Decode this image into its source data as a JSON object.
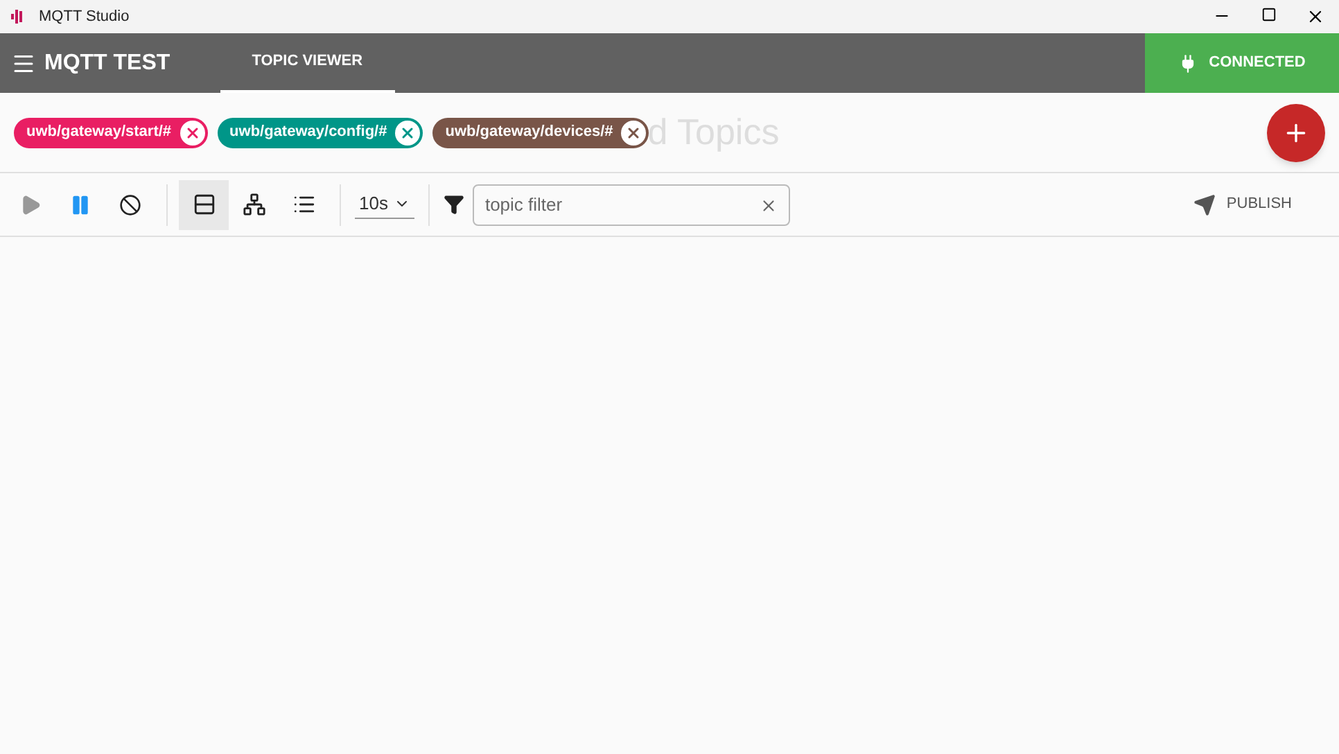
{
  "window": {
    "title": "MQTT Studio"
  },
  "header": {
    "connection_name": "MQTT TEST",
    "tabs": [
      {
        "label": "TOPIC VIEWER",
        "selected": true
      }
    ],
    "status": {
      "label": "CONNECTED",
      "connected": true
    }
  },
  "subscriptions": {
    "chips": [
      {
        "label": "uwb/gateway/start/#",
        "color": "#e91e63"
      },
      {
        "label": "uwb/gateway/config/#",
        "color": "#009688"
      },
      {
        "label": "uwb/gateway/devices/#",
        "color": "#795548"
      }
    ],
    "hint": "d Topics"
  },
  "toolbar": {
    "playback": [
      {
        "kind": "play",
        "selected": false
      },
      {
        "kind": "pause",
        "selected": true
      },
      {
        "kind": "clear",
        "selected": false
      }
    ],
    "views": [
      {
        "kind": "cards",
        "selected": true
      },
      {
        "kind": "tree",
        "selected": false
      },
      {
        "kind": "list",
        "selected": false
      }
    ],
    "interval": "10s",
    "filter": {
      "placeholder": "topic filter"
    },
    "publish": "PUBLISH"
  }
}
